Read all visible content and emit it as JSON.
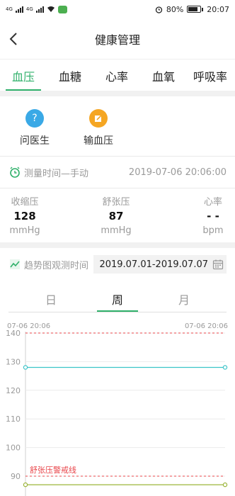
{
  "status_bar": {
    "signal_1": "4G",
    "signal_2": "4G",
    "battery": "80%",
    "time": "20:07",
    "icons": [
      "signal-icon",
      "wifi-icon",
      "wechat-icon",
      "alarm-icon",
      "battery-icon"
    ]
  },
  "header": {
    "title": "健康管理",
    "back_icon": "chevron-left-icon"
  },
  "tabs": [
    {
      "label": "血压",
      "active": true
    },
    {
      "label": "血糖",
      "active": false
    },
    {
      "label": "心率",
      "active": false
    },
    {
      "label": "血氧",
      "active": false
    },
    {
      "label": "呼吸率",
      "active": false
    }
  ],
  "actions": [
    {
      "label": "问医生",
      "icon": "question-icon",
      "color": "#3aa9e6"
    },
    {
      "label": "输血压",
      "icon": "edit-icon",
      "color": "#f5a623"
    }
  ],
  "measurement": {
    "label": "测量时间—手动",
    "datetime": "2019-07-06 20:06:00",
    "icon": "alarm-clock-icon"
  },
  "metrics": [
    {
      "name": "收缩压",
      "value": "128",
      "unit": "mmHg"
    },
    {
      "name": "舒张压",
      "value": "87",
      "unit": "mmHg"
    },
    {
      "name": "心率",
      "value": "- -",
      "unit": "bpm"
    }
  ],
  "trend": {
    "label": "趋势图观测时间",
    "range": "2019.07.01-2019.07.07",
    "icon": "trend-chart-icon",
    "calendar_icon": "calendar-icon"
  },
  "periods": [
    {
      "label": "日",
      "active": false
    },
    {
      "label": "周",
      "active": true
    },
    {
      "label": "月",
      "active": false
    }
  ],
  "colors": {
    "accent": "#2fb06a",
    "systolic_line": "#3cc4c8",
    "diastolic_line": "#9bb53a",
    "warning": "#e8454a"
  },
  "chart_data": {
    "type": "line",
    "x": [
      "07-06 20:06",
      "07-06 20:06"
    ],
    "x_tick_labels": [
      "07-06 20:06",
      "07-06 20:06"
    ],
    "ylim": [
      87,
      140
    ],
    "y_ticks": [
      90,
      100,
      110,
      120,
      130,
      140
    ],
    "grid": true,
    "series": [
      {
        "values": [
          128,
          128
        ],
        "color": "#3cc4c8"
      },
      {
        "values": [
          87,
          87
        ],
        "color": "#9bb53a"
      }
    ],
    "thresholds": [
      {
        "label": "",
        "value": 140,
        "color": "#e8454a"
      },
      {
        "label": "舒张压警戒线",
        "value": 90,
        "color": "#e8454a"
      }
    ]
  }
}
